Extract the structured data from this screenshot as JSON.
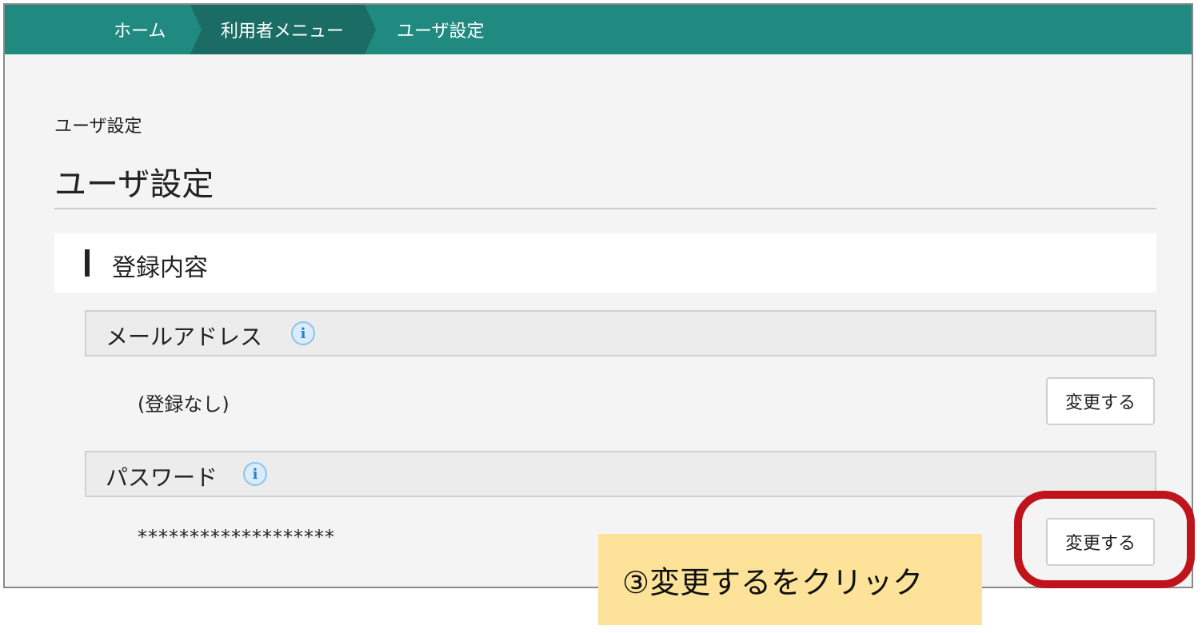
{
  "breadcrumb": {
    "home": "ホーム",
    "user_menu": "利用者メニュー",
    "current": "ユーザ設定"
  },
  "page": {
    "small_title": "ユーザ設定",
    "title": "ユーザ設定"
  },
  "section": {
    "title": "登録内容"
  },
  "fields": {
    "email": {
      "label": "メールアドレス",
      "info_icon": "i",
      "value": "(登録なし)",
      "change_label": "変更する"
    },
    "password": {
      "label": "パスワード",
      "info_icon": "i",
      "value": "*******************",
      "change_label": "変更する"
    }
  },
  "annotation": {
    "callout": "③変更するをクリック",
    "ring_color": "#c0141c",
    "callout_bg": "#fde39a"
  },
  "colors": {
    "navbar": "#208a80",
    "navbar_active": "#1a6c64"
  }
}
